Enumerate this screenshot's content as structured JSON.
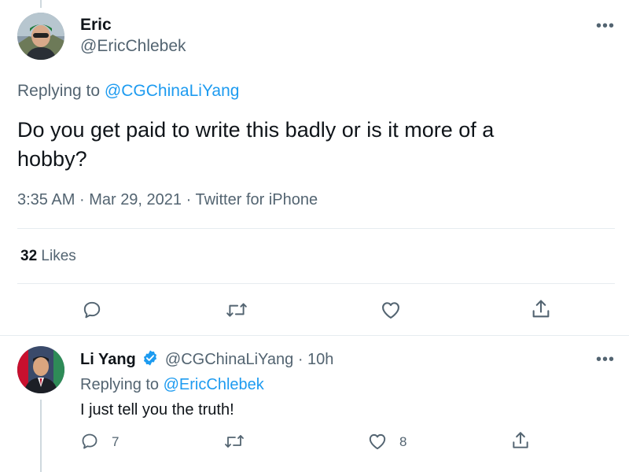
{
  "main_tweet": {
    "display_name": "Eric",
    "handle": "@EricChlebek",
    "replying_prefix": "Replying to ",
    "replying_to": "@CGChinaLiYang",
    "text": "Do you get paid to write this badly or is it more of a hobby?",
    "time": "3:35 AM",
    "date": "Mar 29, 2021",
    "source": "Twitter for iPhone",
    "separator": "·",
    "likes_count": "32",
    "likes_label": "Likes",
    "more_label": "•••"
  },
  "reply_tweet": {
    "display_name": "Li Yang",
    "handle": "@CGChinaLiYang",
    "separator": "·",
    "age": "10h",
    "replying_prefix": "Replying to ",
    "replying_to": "@EricChlebek",
    "text": "I just tell you the truth!",
    "reply_count": "7",
    "like_count": "8",
    "more_label": "•••"
  },
  "icons": [
    "reply-icon",
    "retweet-icon",
    "like-icon",
    "share-icon",
    "verified-badge-icon",
    "more-icon"
  ],
  "colors": {
    "accent": "#1d9bf0",
    "secondary_text": "#536471",
    "divider": "#e6ecf0"
  }
}
